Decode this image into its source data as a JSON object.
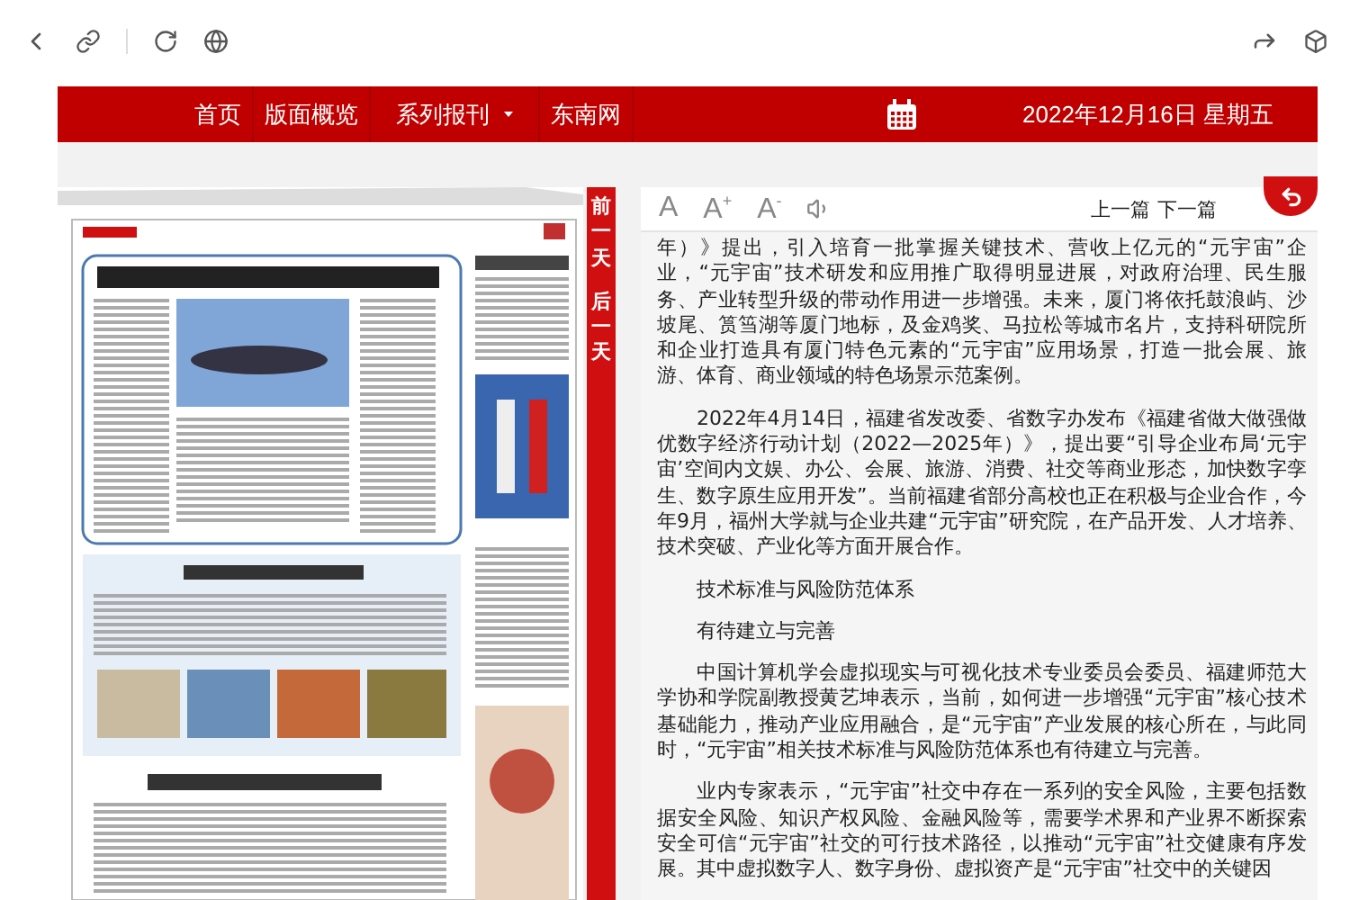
{
  "nav": {
    "items": [
      {
        "label": "首页",
        "kind": "link"
      },
      {
        "label": "版面概览",
        "kind": "link"
      },
      {
        "label": "系列报刊",
        "kind": "dropdown"
      },
      {
        "label": "东南网",
        "kind": "link"
      }
    ],
    "date": "2022年12月16日 星期五"
  },
  "day_tabs": [
    "前一天",
    "后一天"
  ],
  "reader_toolbar": {
    "font_buttons": [
      "A",
      "A$^{+}$",
      "A$^{-}$"
    ],
    "pager": [
      "上一篇",
      "下一篇"
    ]
  },
  "article": {
    "paragraphs": [
      {
        "text": "年）》提出，引入培育一批掌握关键技术、营收上亿元的“元宇宙”企业，“元宇宙”技术研发和应用推广取得明显进展，对政府治理、民生服务、产业转型升级的带动作用进一步增强。未来，厦门将依托鼓浪屿、沙坡尾、筼筜湖等厦门地标，及金鸡奖、马拉松等城市名片，支持科研院所和企业打造具有厦门特色元素的“元宇宙”应用场景，打造一批会展、旅游、体育、商业领域的特色场景示范案例。",
        "indent": false
      },
      {
        "text": "2022年4月14日，福建省发改委、省数字办发布《福建省做大做强做优数字经济行动计划（2022—2025年）》，提出要“引导企业布局‘元宇宙’空间内文娱、办公、会展、旅游、消费、社交等商业形态，加快数字孪生、数字原生应用开发”。当前福建省部分高校也正在积极与企业合作，今年9月，福州大学就与企业共建“元宇宙”研究院，在产品开发、人才培养、技术突破、产业化等方面开展合作。",
        "indent": true
      },
      {
        "text": "技术标准与风险防范体系",
        "indent": true
      },
      {
        "text": "有待建立与完善",
        "indent": true
      },
      {
        "text": "中国计算机学会虚拟现实与可视化技术专业委员会委员、福建师范大学协和学院副教授黄艺坤表示，当前，如何进一步增强“元宇宙”核心技术基础能力，推动产业应用融合，是“元宇宙”产业发展的核心所在，与此同时，“元宇宙”相关技术标准与风险防范体系也有待建立与完善。",
        "indent": true
      },
      {
        "text": "业内专家表示，“元宇宙”社交中存在一系列的安全风险，主要包括数据安全风险、知识产权风险、金融风险等，需要学术界和产业界不断探索安全可信“元宇宙”社交的可行技术路径，以推动“元宇宙”社交健康有序发展。其中虚拟数字人、数字身份、虚拟资产是“元宇宙”社交中的关键因",
        "indent": true
      }
    ]
  }
}
